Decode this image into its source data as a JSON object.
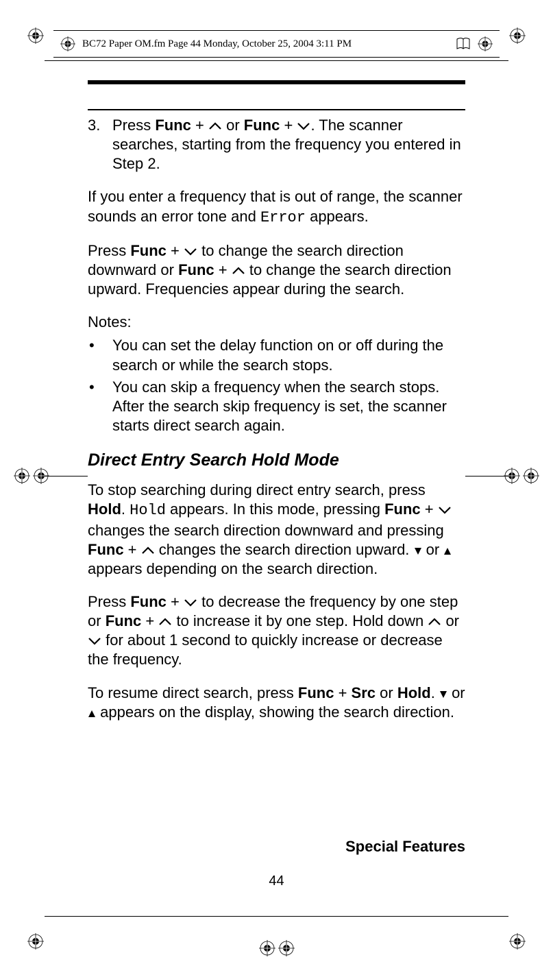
{
  "header": {
    "text": "BC72 Paper OM.fm  Page 44  Monday, October 25, 2004  3:11 PM"
  },
  "step3": {
    "num": "3.",
    "seg1": "Press ",
    "func1": "Func",
    "seg2": " + ",
    "seg3": " or ",
    "func2": "Func",
    "seg4": " + ",
    "seg5": ". The scanner searches, starting from the frequency you entered in Step 2."
  },
  "para1": {
    "seg1": "If you enter a frequency that is out of range, the scanner sounds an error tone and ",
    "error": "Error",
    "seg2": " appears."
  },
  "para2": {
    "seg1": "Press ",
    "func1": "Func",
    "seg2": " + ",
    "seg3": " to change the search direction downward or ",
    "func2": "Func",
    "seg4": " + ",
    "seg5": " to change the search direction upward. Frequencies appear during the search."
  },
  "notes_label": "Notes:",
  "note1": "You can set the delay function on or off during the search or while the search stops.",
  "note2": "You can skip a frequency when the search stops. After the search skip frequency is set, the scan­ner starts direct search again.",
  "heading": "Direct Entry Search Hold Mode",
  "para3": {
    "seg1": "To stop searching during direct entry search, press ",
    "hold1": "Hold",
    "seg2": ". ",
    "hold2": "Hold",
    "seg3": " appears. In this mode, pressing ",
    "func1": "Func",
    "seg4": " + ",
    "seg5": " changes the search direction downward and pressing ",
    "func2": "Func",
    "seg6": " + ",
    "seg7": " changes the search direction upward. ",
    "seg8": " or ",
    "seg9": "  appears depending on the search direction."
  },
  "para4": {
    "seg1": "Press ",
    "func1": "Func",
    "seg2": " + ",
    "seg3": " to decrease the frequency by one step or ",
    "func2": "Func",
    "seg4": " + ",
    "seg5": "  to increase it by one step. Hold down   ",
    "seg6": " or ",
    "seg7": " for about 1 second to quickly increase or decrease the frequency."
  },
  "para5": {
    "seg1": "To resume direct search, press ",
    "func1": "Func",
    "seg2": " + ",
    "src": "Src",
    "seg3": " or ",
    "hold": "Hold",
    "seg4": ". ",
    "seg5": " or ",
    "seg6": " appears on the display, showing the search direction."
  },
  "footer": {
    "title": "Special Features",
    "page": "44"
  }
}
